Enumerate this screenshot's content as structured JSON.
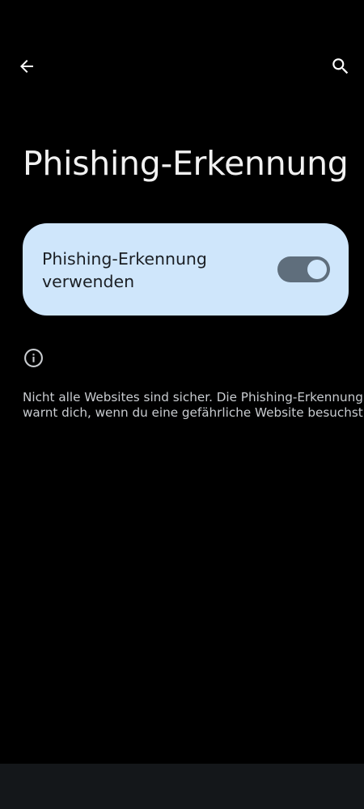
{
  "header": {
    "back_icon": "arrow-left-icon",
    "search_icon": "search-icon"
  },
  "page": {
    "title": "Phishing-Erkennung"
  },
  "toggle": {
    "label_line1": "Phishing-Erkennung",
    "label_line2": "verwenden",
    "state": "on"
  },
  "info": {
    "icon": "info-icon",
    "line1": "Nicht alle Websites sind sicher. Die Phishing-Erkennung",
    "line2": "warnt dich, wenn du eine gefährliche Website besuchst."
  },
  "colors": {
    "background": "#000000",
    "card": "#cfe6fb",
    "switch_track": "#5f6e7c",
    "nav_bar": "#14171a"
  }
}
